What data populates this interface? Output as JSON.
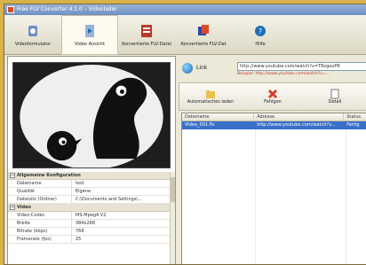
{
  "window": {
    "title": "Free FLV Converter 4.1.0 – Videolader"
  },
  "toolbar": {
    "buttons": [
      {
        "label": "Videoformulator",
        "icon": "gear-icon"
      },
      {
        "label": "Video Ansicht",
        "icon": "video-icon"
      },
      {
        "label": "Konvertierte FLV-Datei",
        "icon": "convert-icon"
      },
      {
        "label": "Konvertierte FLV-Dat",
        "icon": "convert2-icon"
      },
      {
        "label": "Hilfe",
        "icon": "help-icon"
      }
    ]
  },
  "properties": {
    "group1": "Allgemeine Konfiguration",
    "group2": "Video",
    "rows1": [
      {
        "k": "Dateiname",
        "v": "test"
      },
      {
        "k": "Qualität",
        "v": "Eigene"
      },
      {
        "k": "Dateisitz (Ordner)",
        "v": "C:\\Documents and Settings\\..."
      }
    ],
    "rows2": [
      {
        "k": "Video-Codec",
        "v": "MS-Mpeg4 V2"
      },
      {
        "k": "Breite",
        "v": "384x288"
      },
      {
        "k": "Bitrate (kbps)",
        "v": "768"
      },
      {
        "k": "Framerate (fps)",
        "v": "25"
      }
    ]
  },
  "url": {
    "label": "Link",
    "value": "http://www.youtube.com/watch?v=T8xgexPR",
    "hint": "Beispiel: http://www.youtube.com/watch?v=..."
  },
  "subtoolbar": {
    "add_label": "Automatisches laden",
    "remove_label": "Fehlgen",
    "more_label": "Detail"
  },
  "list": {
    "headers": [
      "Dateiname",
      "Adresse",
      "Status"
    ],
    "rows": [
      [
        "Video_001.flv",
        "http://www.youtube.com/watch?v...",
        "Fertig"
      ]
    ]
  },
  "colors": {
    "accent": "#3a6fc8",
    "frame": "#d8b24a"
  }
}
